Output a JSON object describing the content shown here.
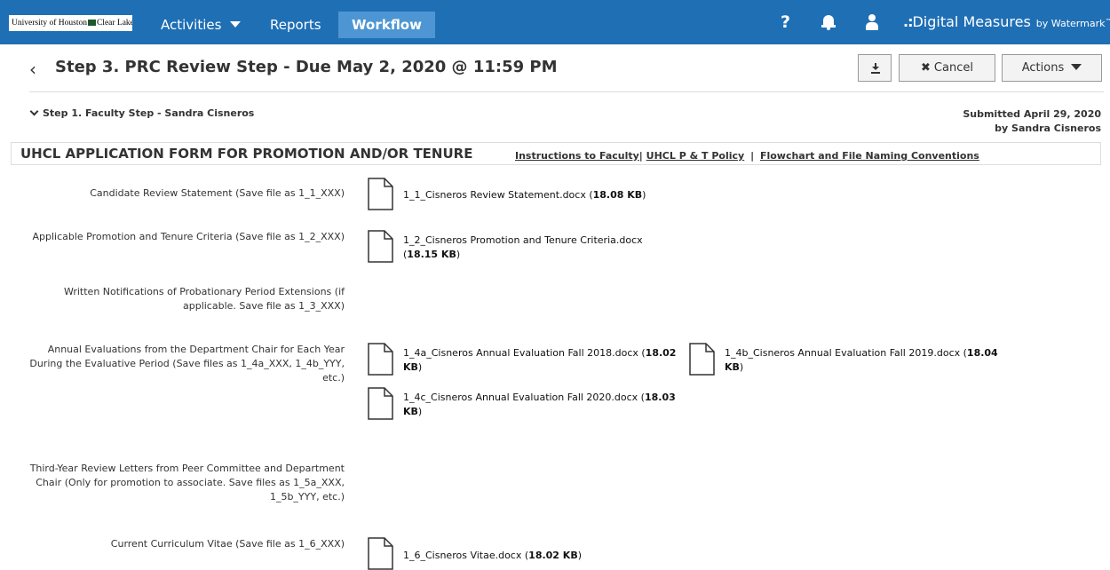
{
  "nav": {
    "logo_text_1": "University of Houston",
    "logo_text_2": "Clear Lake",
    "activities": "Activities",
    "reports": "Reports",
    "workflow": "Workflow",
    "help": "?",
    "brand_dots": ".:",
    "brand_name": "Digital Measures",
    "brand_by": "by Watermark",
    "brand_tm": "™"
  },
  "header": {
    "back_glyph": "‹",
    "title": "Step 3. PRC Review Step - Due May 2, 2020 @ 11:59 PM",
    "cancel_icon": "✖",
    "cancel": "Cancel",
    "actions": "Actions"
  },
  "step1": {
    "label": "Step 1. Faculty Step - Sandra Cisneros",
    "submitted_line1": "Submitted April 29, 2020",
    "submitted_line2": "by Sandra Cisneros"
  },
  "form": {
    "title": "UHCL APPLICATION FORM FOR PROMOTION AND/OR TENURE",
    "link1": "Instructions to Faculty",
    "sep1": "|",
    "link2": "UHCL P & T Policy",
    "sep2": "|",
    "link3": "Flowchart and File Naming Conventions"
  },
  "rows": {
    "r1": {
      "label": "Candidate Review Statement (Save file as 1_1_XXX)",
      "file": {
        "name": "1_1_Cisneros Review Statement.docx (",
        "size": "18.08 KB",
        "close": ")"
      }
    },
    "r2": {
      "label": "Applicable Promotion and Tenure Criteria (Save file as 1_2_XXX)",
      "file": {
        "name": "1_2_Cisneros Promotion and Tenure Criteria.docx",
        "open": "(",
        "size": "18.15 KB",
        "close": ")"
      }
    },
    "r3": {
      "label_l1": "Written Notifications of Probationary Period Extensions (if",
      "label_l2": "applicable. Save file as 1_3_XXX)"
    },
    "r4": {
      "label_l1": "Annual Evaluations from the Department Chair for Each Year",
      "label_l2": "During the Evaluative Period (Save files as 1_4a_XXX, 1_4b_YYY,",
      "label_l3": "etc.)",
      "file_a": {
        "name": "1_4a_Cisneros Annual Evaluation Fall 2018.docx (",
        "size_1": "18.02",
        "size_2": "KB",
        "close": ")"
      },
      "file_b": {
        "name": "1_4b_Cisneros Annual Evaluation Fall 2019.docx (",
        "size_1": "18.04",
        "size_2": "KB",
        "close": ")"
      },
      "file_c": {
        "name": "1_4c_Cisneros Annual Evaluation Fall 2020.docx (",
        "size_1": "18.03",
        "size_2": "KB",
        "close": ")"
      }
    },
    "r5": {
      "label_l1": "Third-Year Review Letters from Peer Committee and Department",
      "label_l2": "Chair (Only for promotion to associate. Save files as 1_5a_XXX,",
      "label_l3": "1_5b_YYY, etc.)"
    },
    "r6": {
      "label": "Current Curriculum Vitae (Save file as 1_6_XXX)",
      "file": {
        "name": "1_6_Cisneros Vitae.docx (",
        "size": "18.02 KB",
        "close": ")"
      }
    }
  }
}
